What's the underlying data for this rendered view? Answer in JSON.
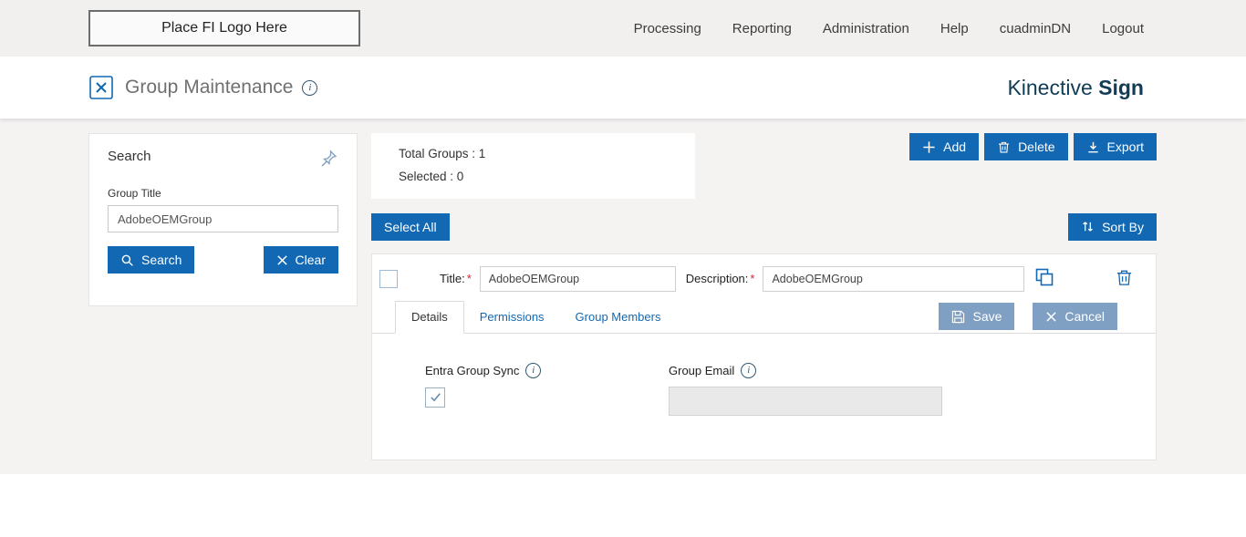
{
  "header": {
    "logo_text": "Place FI Logo Here",
    "nav": [
      "Processing",
      "Reporting",
      "Administration",
      "Help",
      "cuadminDN",
      "Logout"
    ]
  },
  "titlebar": {
    "title": "Group Maintenance",
    "brand_name": "Kinective",
    "brand_suffix": "Sign"
  },
  "search_panel": {
    "title": "Search",
    "group_title_label": "Group Title",
    "group_title_value": "AdobeOEMGroup",
    "search_button": "Search",
    "clear_button": "Clear"
  },
  "summary": {
    "total_groups": "Total Groups : 1",
    "selected": "Selected : 0"
  },
  "toolbar": {
    "add_label": "Add",
    "delete_label": "Delete",
    "export_label": "Export",
    "select_all_label": "Select All",
    "sort_by_label": "Sort By"
  },
  "group_row": {
    "title_label": "Title:",
    "required_marker": "*",
    "title_value": "AdobeOEMGroup",
    "description_label": "Description:",
    "description_value": "AdobeOEMGroup",
    "tabs": [
      "Details",
      "Permissions",
      "Group Members"
    ],
    "active_tab": "Details",
    "save_label": "Save",
    "cancel_label": "Cancel",
    "details_tab": {
      "entra_label": "Entra Group Sync",
      "entra_checked": true,
      "email_label": "Group Email",
      "email_value": ""
    }
  },
  "colors": {
    "primary_blue": "#1268b3",
    "muted_button_blue": "#7fa0c2",
    "brand_dark": "#113c55",
    "required_red": "#d9232e"
  }
}
